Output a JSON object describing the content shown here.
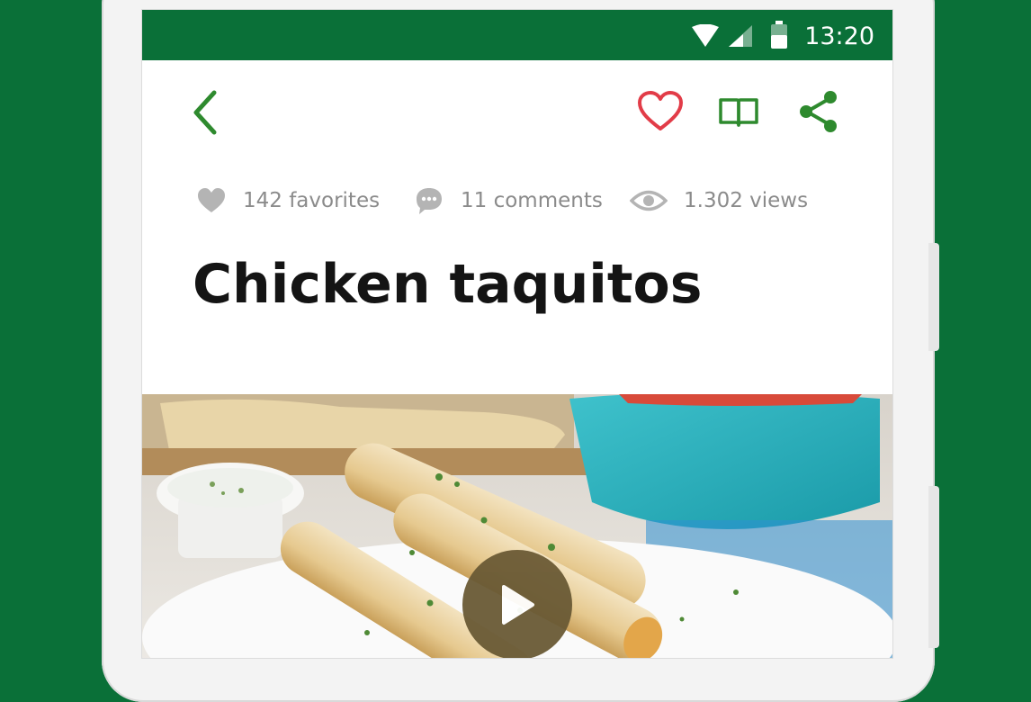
{
  "status_bar": {
    "time": "13:20"
  },
  "app_bar": {
    "icons": [
      "back-icon",
      "heart-icon",
      "book-icon",
      "share-icon"
    ]
  },
  "stats": {
    "favorites": "142 favorites",
    "comments": "11 comments",
    "views": "1.302 views"
  },
  "recipe": {
    "title": "Chicken taquitos"
  },
  "colors": {
    "brand_green": "#0a7038",
    "heart_red": "#e23c48",
    "stat_gray": "#8b8b8b",
    "play_brown": "#6a5a35"
  }
}
